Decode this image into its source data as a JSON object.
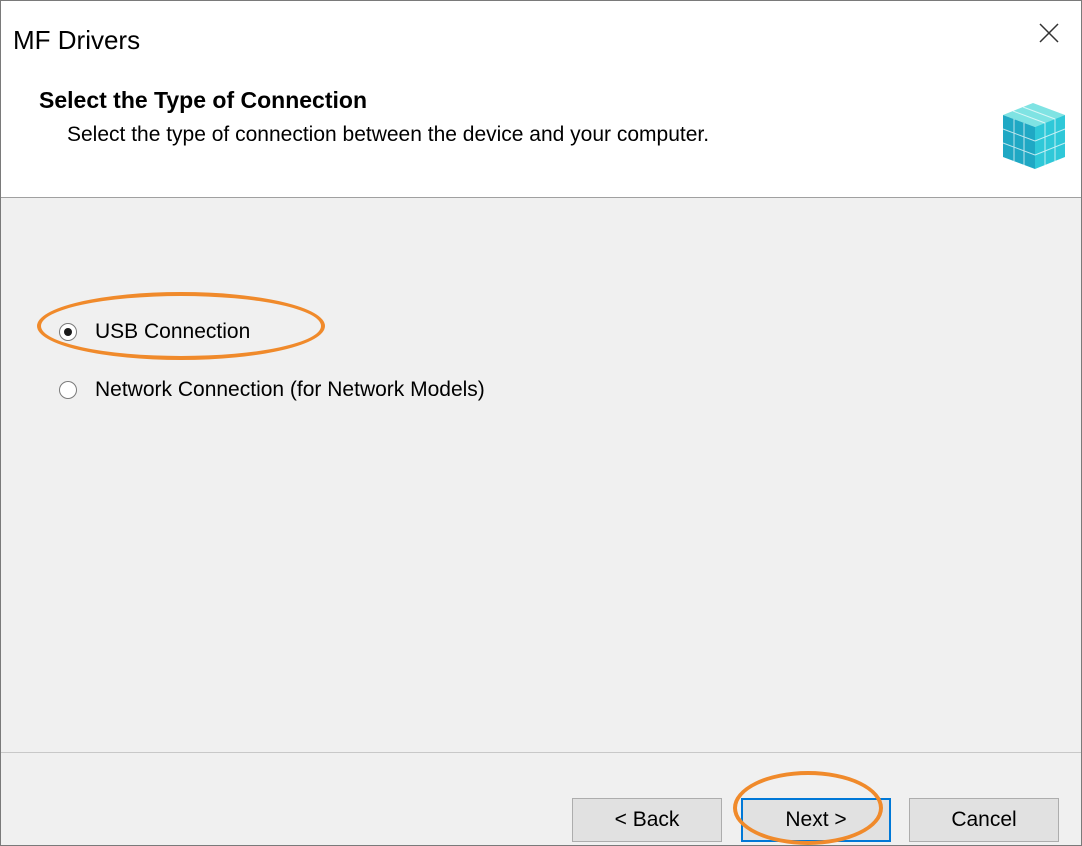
{
  "window": {
    "title": "MF Drivers",
    "close_icon": "close-icon"
  },
  "header": {
    "title": "Select the Type of Connection",
    "subtitle": "Select the type of connection between the device and your computer.",
    "logo_icon": "installer-cube-icon"
  },
  "options": [
    {
      "label": "USB Connection",
      "selected": true
    },
    {
      "label": "Network Connection (for Network Models)",
      "selected": false
    }
  ],
  "buttons": {
    "back": "< Back",
    "next": "Next >",
    "cancel": "Cancel"
  },
  "colors": {
    "annotation": "#f08a2b",
    "background": "#f0f0f0",
    "header_background": "#ffffff"
  }
}
